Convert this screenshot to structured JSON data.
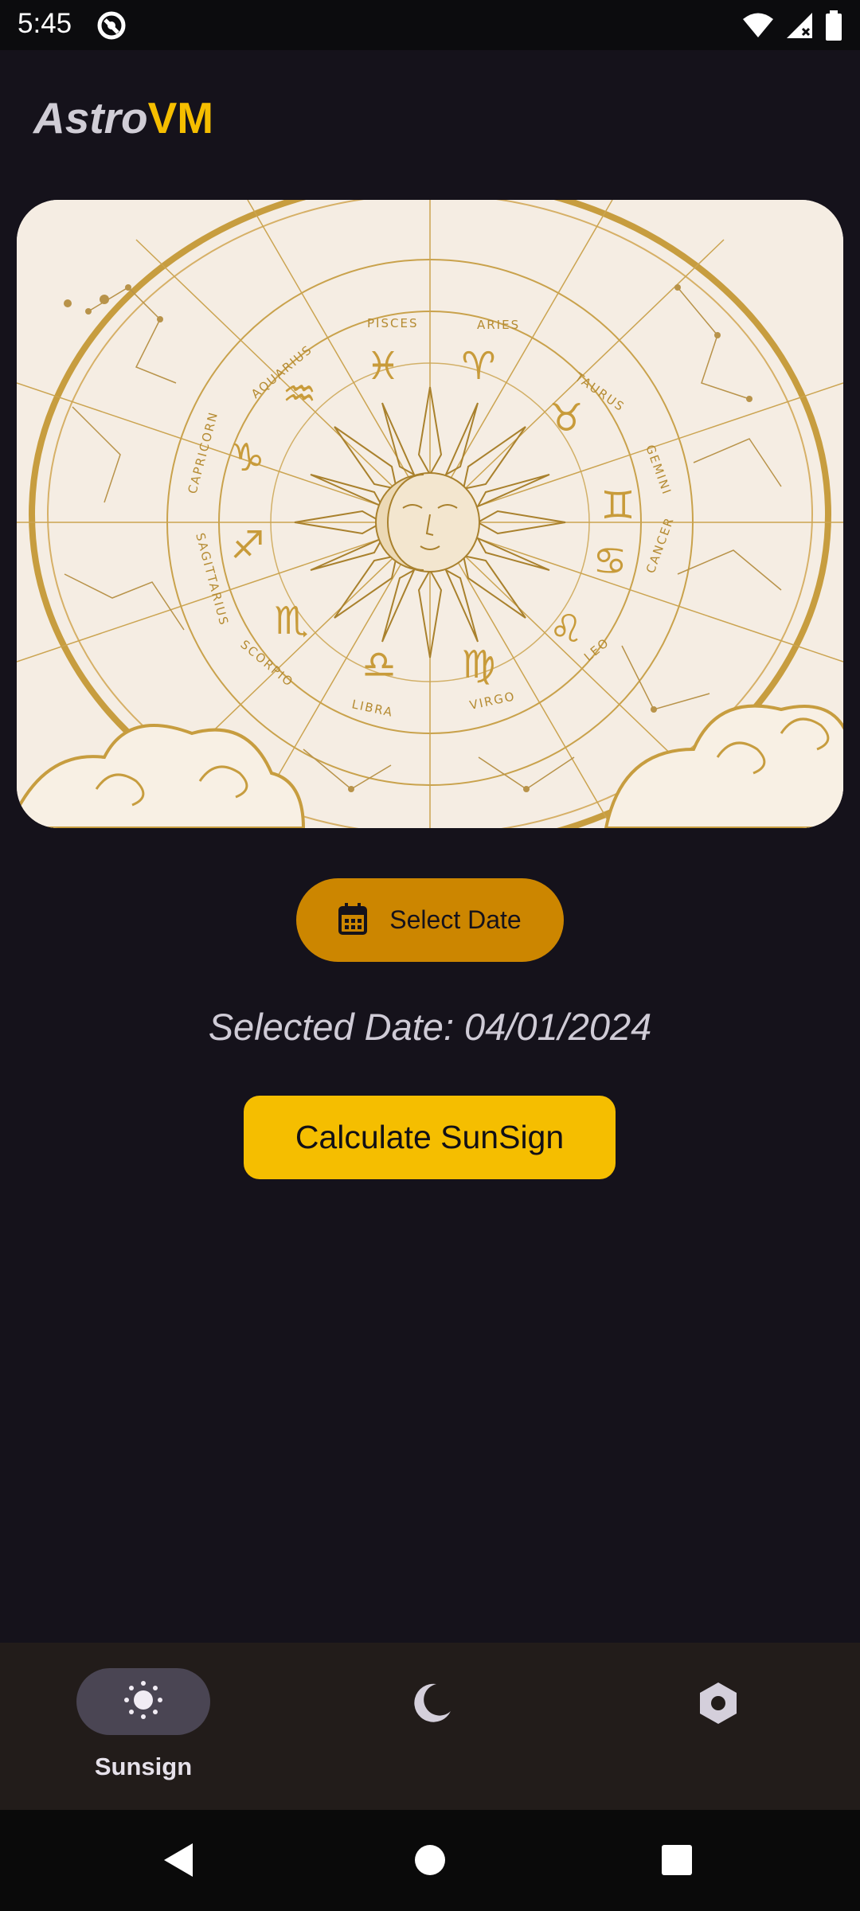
{
  "status_bar": {
    "time": "5:45"
  },
  "app": {
    "title_part1": "Astro",
    "title_part2": "VM"
  },
  "hero": {
    "zodiac_labels": [
      "PISCES",
      "ARIES",
      "TAURUS",
      "GEMINI",
      "CANCER",
      "LEO",
      "VIRGO",
      "LIBRA",
      "SCORPIO",
      "SAGITTARIUS",
      "CAPRICORN",
      "AQUARIUS"
    ]
  },
  "actions": {
    "select_date_label": "Select Date",
    "selected_date_text": "Selected Date: 04/01/2024",
    "calculate_label": "Calculate SunSign"
  },
  "bottom_nav": {
    "items": [
      {
        "label": "Sunsign",
        "icon": "sun-icon",
        "selected": true
      },
      {
        "label": "",
        "icon": "moon-icon",
        "selected": false
      },
      {
        "label": "",
        "icon": "settings-icon",
        "selected": false
      }
    ]
  },
  "colors": {
    "background": "#15121b",
    "accent_yellow": "#f5be00",
    "accent_orange": "#cc8600",
    "nav_background": "#221c1a"
  }
}
